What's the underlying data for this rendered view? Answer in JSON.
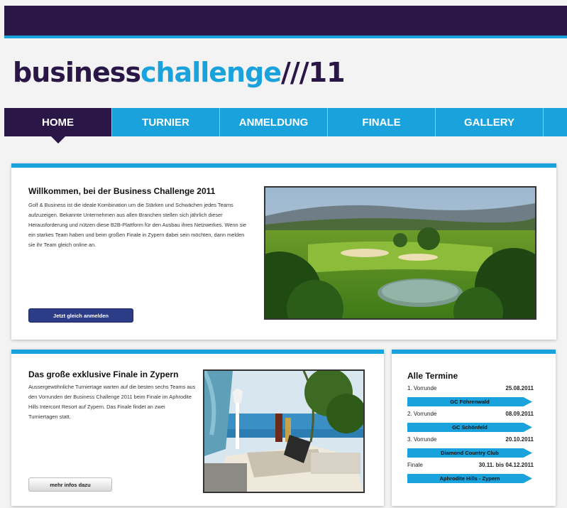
{
  "header": {
    "logo_part1": "business",
    "logo_part2": "challenge",
    "logo_part3": "///11"
  },
  "nav": {
    "items": [
      "HOME",
      "TURNIER",
      "ANMELDUNG",
      "FINALE",
      "GALLERY"
    ],
    "active": "HOME"
  },
  "welcome": {
    "title": "Willkommen, bei der Business Challenge 2011",
    "text": "Golf & Business ist die ideale Kombination um die Stärken und Schwächen jedes Teams aufzuzeigen. Bekannte Unternehmen aus allen Branchen stellen sich jährlich dieser Herausforderung und nützen diese B2B-Plattform für den Ausbau ihres Netzwerkes. Wenn sie ein starkes Team haben und beim großen Finale in Zypern dabei sein möchten, dann melden sie ihr Team gleich online an.",
    "button": "Jetzt gleich anmelden"
  },
  "finale": {
    "title": "Das große exklusive Finale in Zypern",
    "text": "Aussergewöhnliche Turniertage warten auf die besten sechs Teams aus den Vorrunden der Business Challenge 2011 beim Finale im Aphrodite Hills Intercont Resort auf Zypern. Das Finale findet an zwei Turniertagen statt.",
    "button": "mehr infos dazu"
  },
  "termine": {
    "title": "Alle Termine",
    "items": [
      {
        "round": "1. Vorrunde",
        "date": "25.08.2011",
        "place": "GC Föhrenwald"
      },
      {
        "round": "2. Vorrunde",
        "date": "08.09.2011",
        "place": "GC Schönfeld"
      },
      {
        "round": "3. Vorrunde",
        "date": "20.10.2011",
        "place": "Diamond Country Club"
      },
      {
        "round": "Finale",
        "date": "30.11. bis 04.12.2011",
        "place": "Aphrodite Hills - Zypern"
      }
    ]
  },
  "colors": {
    "dark_purple": "#2a1748",
    "accent_blue": "#1aa2dc",
    "button_blue": "#2c3c86"
  }
}
